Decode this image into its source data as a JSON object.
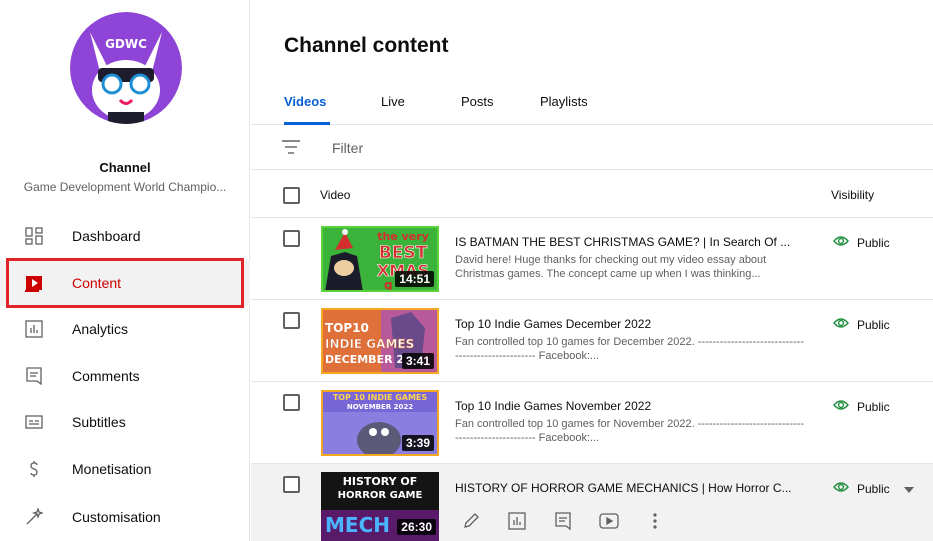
{
  "sidebar": {
    "channel_label": "Channel",
    "channel_name": "Game Development World Champio...",
    "avatar_text": "GDWC",
    "items": [
      {
        "label": "Dashboard",
        "icon": "dashboard-icon"
      },
      {
        "label": "Content",
        "icon": "content-icon"
      },
      {
        "label": "Analytics",
        "icon": "analytics-icon"
      },
      {
        "label": "Comments",
        "icon": "comments-icon"
      },
      {
        "label": "Subtitles",
        "icon": "subtitles-icon"
      },
      {
        "label": "Monetisation",
        "icon": "monetisation-icon"
      },
      {
        "label": "Customisation",
        "icon": "customisation-icon"
      }
    ]
  },
  "main": {
    "title": "Channel content",
    "tabs": [
      {
        "label": "Videos"
      },
      {
        "label": "Live"
      },
      {
        "label": "Posts"
      },
      {
        "label": "Playlists"
      }
    ],
    "filter_placeholder": "Filter",
    "columns": {
      "video": "Video",
      "visibility": "Visibility"
    },
    "videos": [
      {
        "title": "IS BATMAN THE BEST CHRISTMAS GAME? | In Search Of ...",
        "description": "David here! Huge thanks for checking out my video essay about Christmas games. The concept came up when I was thinking...",
        "duration": "14:51",
        "visibility": "Public",
        "thumb_text": [
          "the very",
          "BEST",
          "XMAS",
          "g"
        ]
      },
      {
        "title": "Top 10 Indie Games December 2022",
        "description": "Fan controlled top 10 games for December 2022. --------------------------------------------------- Facebook:...",
        "duration": "3:41",
        "visibility": "Public",
        "thumb_text": [
          "TOP10",
          "INDIE GAMES",
          "DECEMBER 2"
        ]
      },
      {
        "title": "Top 10 Indie Games November 2022",
        "description": "Fan controlled top 10 games for November 2022. --------------------------------------------------- Facebook:...",
        "duration": "3:39",
        "visibility": "Public",
        "thumb_text": [
          "TOP 10 INDIE GAMES",
          "NOVEMBER 2022"
        ]
      },
      {
        "title": "HISTORY OF HORROR GAME MECHANICS | How Horror C...",
        "description": "",
        "duration": "26:30",
        "visibility": "Public",
        "thumb_text": [
          "HISTORY OF",
          "HORROR GAME",
          "MECH"
        ]
      }
    ]
  },
  "colors": {
    "accent": "#065fd4",
    "active_nav": "#cc0000",
    "highlight": "#e0242a",
    "public_icon": "#1e8e3e"
  }
}
